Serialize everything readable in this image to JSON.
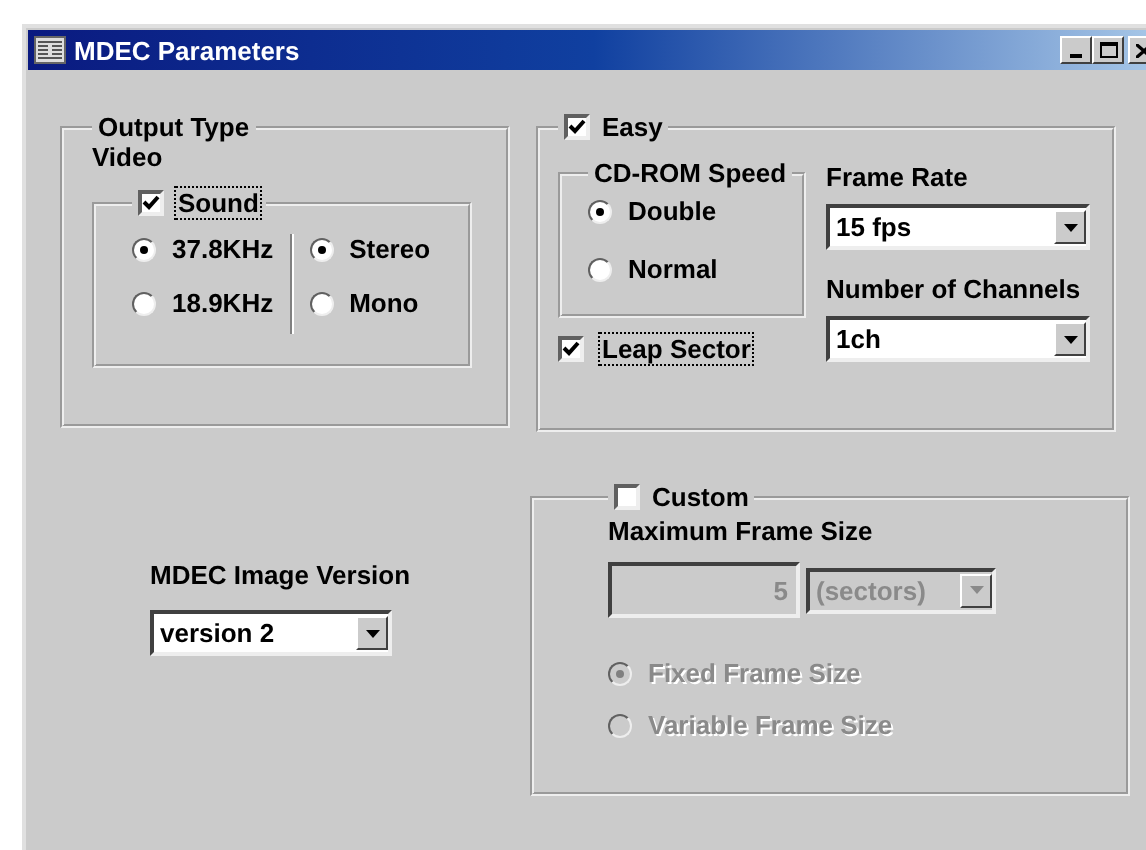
{
  "window": {
    "title": "MDEC Parameters"
  },
  "output_type": {
    "title": "Output Type",
    "video_label": "Video",
    "sound": {
      "label": "Sound",
      "checked": true,
      "frequencies": [
        {
          "label": "37.8KHz",
          "selected": true
        },
        {
          "label": "18.9KHz",
          "selected": false
        }
      ],
      "channels": [
        {
          "label": "Stereo",
          "selected": true
        },
        {
          "label": "Mono",
          "selected": false
        }
      ]
    }
  },
  "image_version": {
    "label": "MDEC Image Version",
    "value": "version 2"
  },
  "easy": {
    "label": "Easy",
    "checked": true,
    "cdrom_speed": {
      "title": "CD-ROM Speed",
      "options": [
        {
          "label": "Double",
          "selected": true
        },
        {
          "label": "Normal",
          "selected": false
        }
      ]
    },
    "leap_sector": {
      "label": "Leap Sector",
      "checked": true
    },
    "frame_rate": {
      "label": "Frame Rate",
      "value": "15 fps"
    },
    "channels": {
      "label": "Number of Channels",
      "value": "1ch"
    }
  },
  "custom": {
    "label": "Custom",
    "checked": false,
    "max_frame_size": {
      "label": "Maximum Frame Size",
      "value": "5",
      "unit": "(sectors)",
      "disabled": true
    },
    "modes": [
      {
        "label": "Fixed Frame Size",
        "selected": true,
        "disabled": true
      },
      {
        "label": "Variable Frame Size",
        "selected": false,
        "disabled": true
      }
    ]
  }
}
